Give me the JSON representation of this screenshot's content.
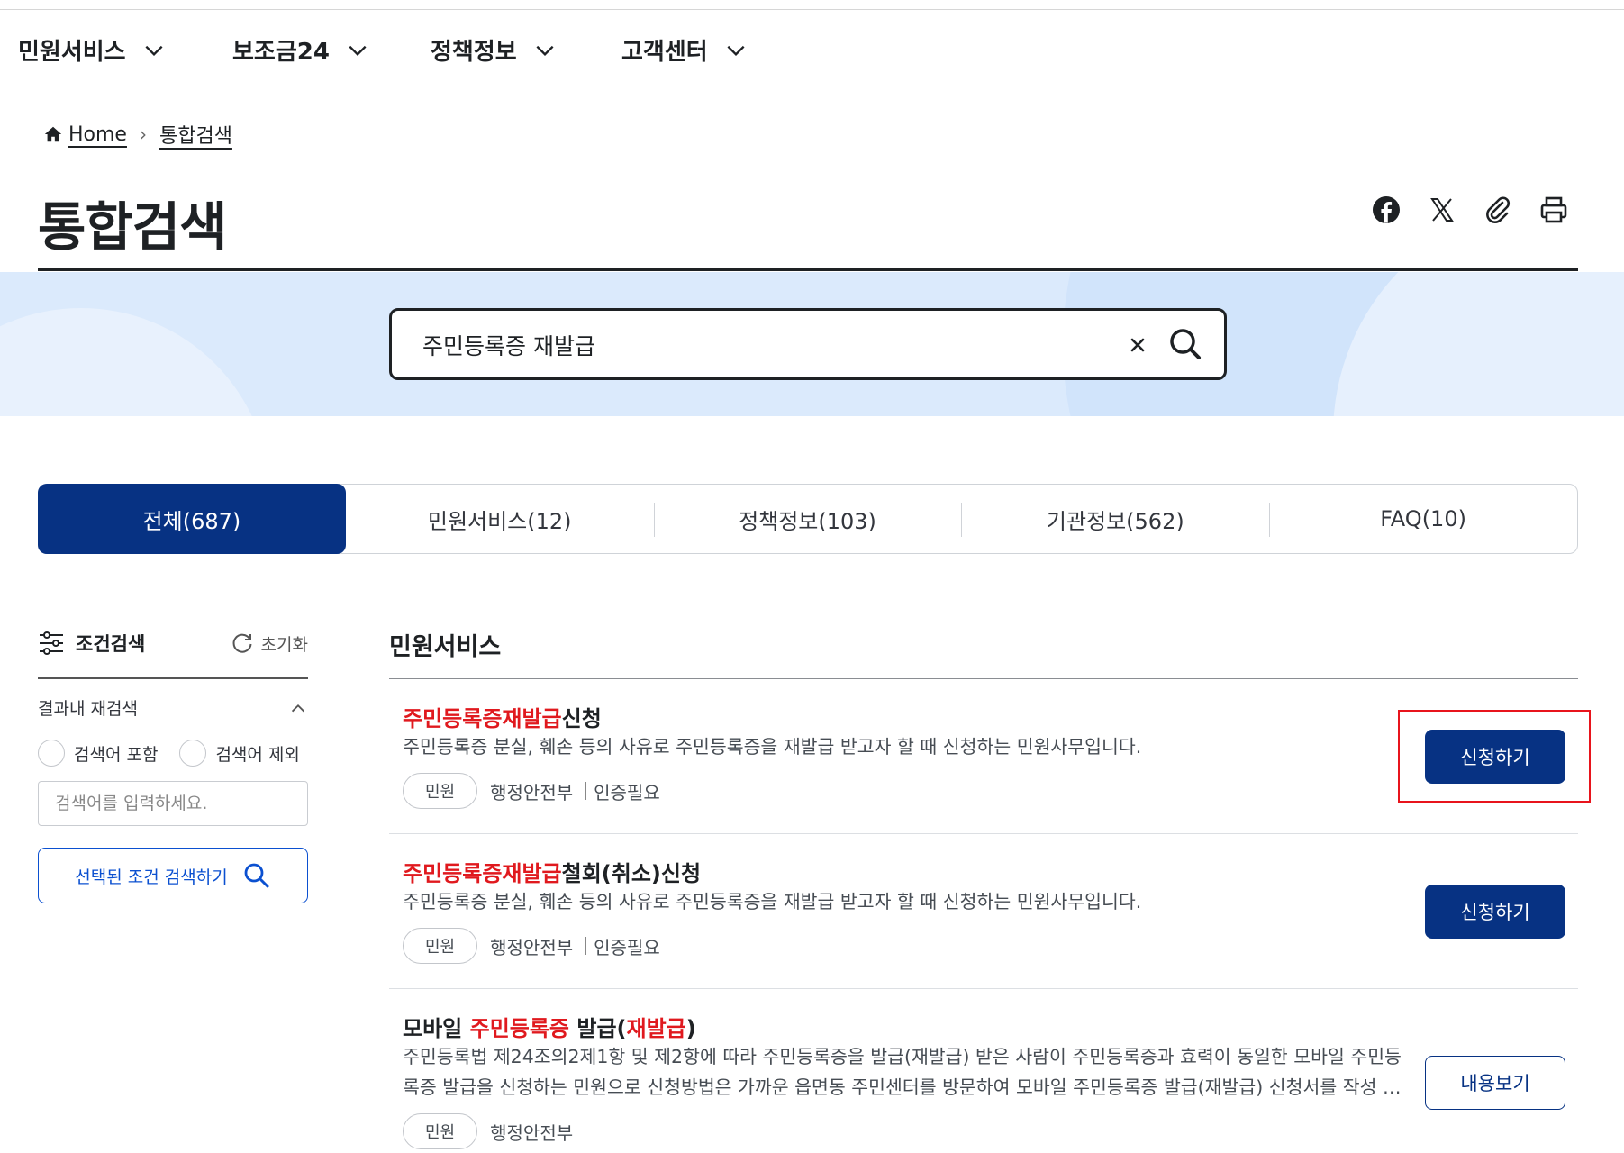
{
  "nav": {
    "items": [
      {
        "label": "민원서비스"
      },
      {
        "label": "보조금24"
      },
      {
        "label": "정책정보"
      },
      {
        "label": "고객센터"
      }
    ]
  },
  "breadcrumb": {
    "home": "Home",
    "current": "통합검색"
  },
  "page": {
    "title": "통합검색"
  },
  "share_icons": [
    "facebook-icon",
    "x-icon",
    "link-clip-icon",
    "print-icon"
  ],
  "search": {
    "value": "주민등록증 재발급"
  },
  "tabs": [
    {
      "label": "전체(687)",
      "active": true
    },
    {
      "label": "민원서비스(12)",
      "active": false
    },
    {
      "label": "정책정보(103)",
      "active": false
    },
    {
      "label": "기관정보(562)",
      "active": false
    },
    {
      "label": "FAQ(10)",
      "active": false
    }
  ],
  "sidebar": {
    "filter_title": "조건검색",
    "reset_label": "초기화",
    "research_label": "결과내 재검색",
    "radio_include": "검색어 포함",
    "radio_exclude": "검색어 제외",
    "input_placeholder": "검색어를 입력하세요.",
    "search_button": "선택된 조건 검색하기"
  },
  "results": {
    "section_title": "민원서비스",
    "items": [
      {
        "title_hl": "주민등록증재발급",
        "title_rest": "신청",
        "desc": "주민등록증 분실, 훼손 등의 사유로 주민등록증을 재발급 받고자 할 때 신청하는 민원사무입니다.",
        "tag": "민원",
        "org": "행정안전부",
        "auth": "인증필요",
        "action": "신청하기"
      },
      {
        "title_hl": "주민등록증재발급",
        "title_rest": "철회(취소)신청",
        "desc": "주민등록증 분실, 훼손 등의 사유로 주민등록증을 재발급 받고자 할 때 신청하는 민원사무입니다.",
        "tag": "민원",
        "org": "행정안전부",
        "auth": "인증필요",
        "action": "신청하기"
      },
      {
        "title_pre": "모바일 ",
        "title_hl": "주민등록증",
        "title_mid": " 발급(",
        "title_hl2": "재발급",
        "title_post": ")",
        "desc": "주민등록법 제24조의2제1항 및 제2항에 따라 주민등록증을 발급(재발급) 받은 사람이 주민등록증과 효력이 동일한 모바일 주민등록증 발급을 신청하는 민원으로 신청방법은 가까운 읍면동 주민센터를 방문하여 모바일 주민등록증 발급(재발급) 신청서를 작성 …",
        "tag": "민원",
        "org": "행정안전부",
        "action": "내용보기"
      }
    ]
  },
  "colors": {
    "primary": "#073283",
    "highlight": "#e0191e",
    "hero_bg": "#dbeafc",
    "focus_outline": "#e8141c"
  }
}
